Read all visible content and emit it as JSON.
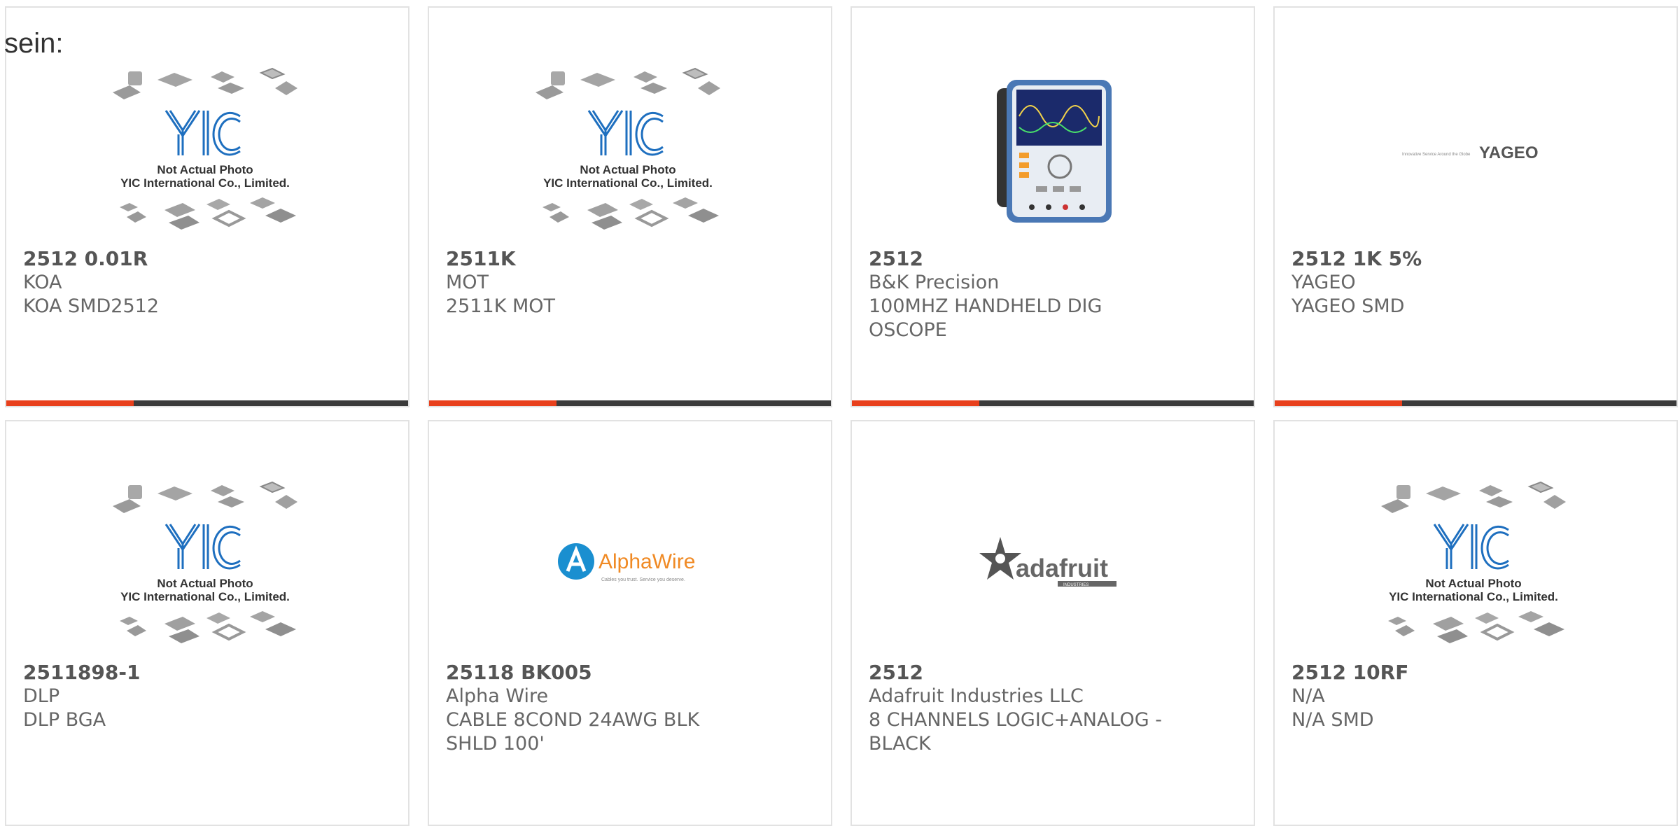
{
  "page": {
    "label": "sein:"
  },
  "colors": {
    "accent": "#e8401c",
    "bar": "#3b3b3b",
    "yic_blue": "#1e6fbf"
  },
  "placeholder": {
    "line1": "Not Actual Photo",
    "line2": "YIC International Co., Limited."
  },
  "logos": {
    "yageo_tagline": "Innovative Service Around the Globe",
    "yageo": "YAGEO",
    "alphawire": "AlphaWire",
    "alphawire_tagline": "Cables you trust. Service you deserve.",
    "adafruit": "adafruit",
    "adafruit_sub": "INDUSTRIES"
  },
  "products": [
    {
      "part": "2512 0.01R",
      "manufacturer": "KOA",
      "description": "KOA SMD2512",
      "image": "yic-placeholder"
    },
    {
      "part": "2511K",
      "manufacturer": "MOT",
      "description": "2511K MOT",
      "image": "yic-placeholder"
    },
    {
      "part": "2512",
      "manufacturer": "B&K Precision",
      "description": "100MHZ HANDHELD DIG OSCOPE",
      "image": "oscilloscope"
    },
    {
      "part": "2512 1K 5%",
      "manufacturer": "YAGEO",
      "description": "YAGEO SMD",
      "image": "yageo-logo"
    },
    {
      "part": "2511898-1",
      "manufacturer": "DLP",
      "description": "DLP BGA",
      "image": "yic-placeholder"
    },
    {
      "part": "25118 BK005",
      "manufacturer": "Alpha Wire",
      "description": "CABLE 8COND 24AWG BLK SHLD 100'",
      "image": "alphawire-logo"
    },
    {
      "part": "2512",
      "manufacturer": "Adafruit Industries LLC",
      "description": "8 CHANNELS LOGIC+ANALOG - BLACK",
      "image": "adafruit-logo"
    },
    {
      "part": "2512 10RF",
      "manufacturer": "N/A",
      "description": "N/A SMD",
      "image": "yic-placeholder"
    }
  ]
}
